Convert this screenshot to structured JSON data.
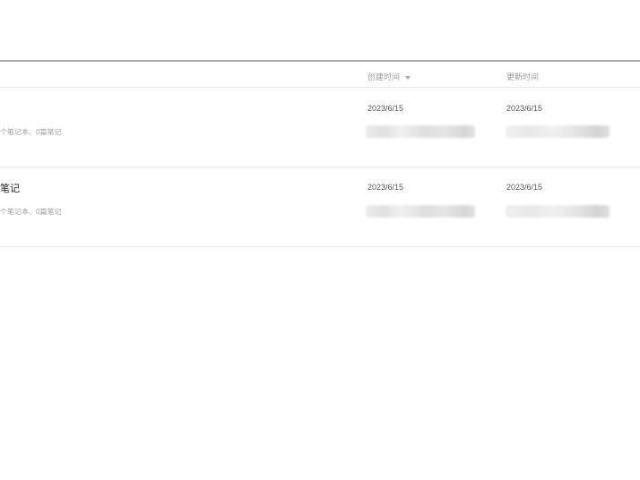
{
  "table": {
    "headers": {
      "created": "创建时间",
      "updated": "更新时间"
    },
    "rows": [
      {
        "title": "",
        "subtitle": "个笔记本、0篇笔记",
        "created_date": "2023/6/15",
        "updated_date": "2023/6/15"
      },
      {
        "title": "笔记",
        "subtitle": "个笔记本、0篇笔记",
        "created_date": "2023/6/15",
        "updated_date": "2023/6/15"
      }
    ]
  },
  "icons": {
    "sort": "sort-caret-down-icon"
  },
  "colors": {
    "header_border": "#a7adb3",
    "row_border": "#ececec",
    "header_text": "#9a9a9a",
    "date_text": "#555555"
  }
}
